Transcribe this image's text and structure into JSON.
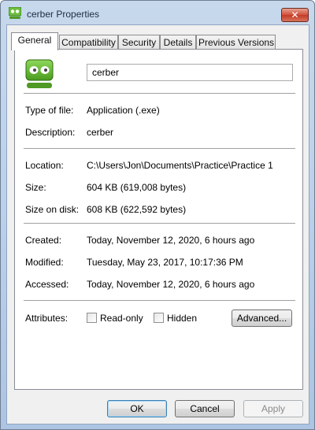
{
  "window": {
    "title": "cerber Properties",
    "close_label": "✕",
    "accent": "#5aa02c"
  },
  "tabs": [
    {
      "label": "General",
      "active": true
    },
    {
      "label": "Compatibility",
      "active": false
    },
    {
      "label": "Security",
      "active": false
    },
    {
      "label": "Details",
      "active": false
    },
    {
      "label": "Previous Versions",
      "active": false
    }
  ],
  "general": {
    "file_name": "cerber",
    "file_icon": "robo-app-icon",
    "rows_type": [
      {
        "label": "Type of file:",
        "value": "Application (.exe)"
      },
      {
        "label": "Description:",
        "value": "cerber"
      }
    ],
    "rows_location": [
      {
        "label": "Location:",
        "value": "C:\\Users\\Jon\\Documents\\Practice\\Practice 1"
      },
      {
        "label": "Size:",
        "value": "604 KB (619,008 bytes)"
      },
      {
        "label": "Size on disk:",
        "value": "608 KB (622,592 bytes)"
      }
    ],
    "rows_dates": [
      {
        "label": "Created:",
        "value": "Today, November 12, 2020, 6 hours ago"
      },
      {
        "label": "Modified:",
        "value": "Tuesday, May 23, 2017, 10:17:36 PM"
      },
      {
        "label": "Accessed:",
        "value": "Today, November 12, 2020, 6 hours ago"
      }
    ],
    "attributes": {
      "label": "Attributes:",
      "readonly_label": "Read-only",
      "readonly_checked": false,
      "hidden_label": "Hidden",
      "hidden_checked": false,
      "advanced_label": "Advanced..."
    }
  },
  "footer": {
    "ok_label": "OK",
    "cancel_label": "Cancel",
    "apply_label": "Apply"
  }
}
